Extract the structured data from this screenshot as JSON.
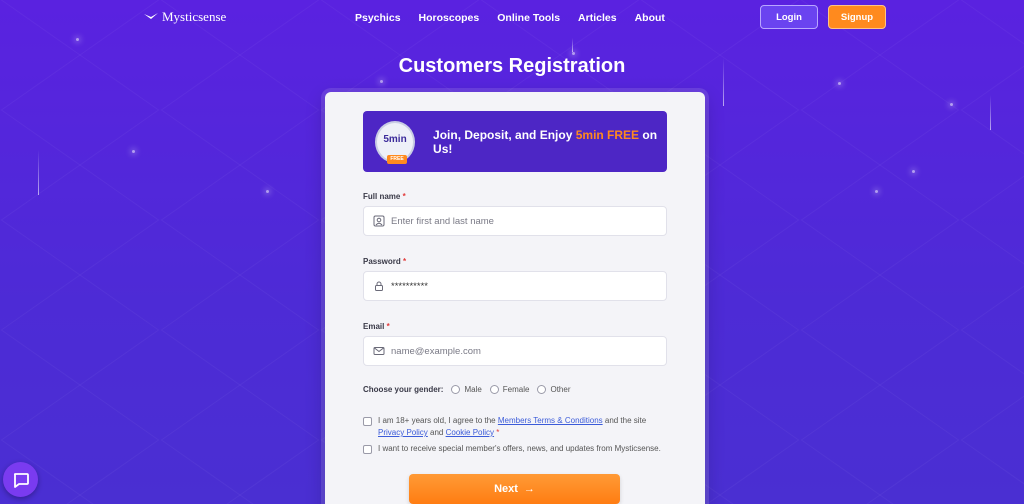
{
  "header": {
    "logo_text": "Mysticsense",
    "nav": [
      "Psychics",
      "Horoscopes",
      "Online Tools",
      "Articles",
      "About"
    ],
    "login_label": "Login",
    "signup_label": "Signup"
  },
  "page": {
    "title": "Customers Registration"
  },
  "promo": {
    "badge_top": "5min",
    "badge_bottom": "FREE",
    "text_before": "Join, Deposit, and Enjoy ",
    "text_highlight": "5min FREE",
    "text_after": " on Us!"
  },
  "form": {
    "full_name": {
      "label": "Full name",
      "required": "*",
      "placeholder": "Enter first and last name"
    },
    "password": {
      "label": "Password",
      "required": "*",
      "value": "**********"
    },
    "email": {
      "label": "Email",
      "required": "*",
      "placeholder": "name@example.com"
    },
    "gender": {
      "label": "Choose your gender:",
      "options": [
        "Male",
        "Female",
        "Other"
      ]
    },
    "terms": {
      "text1": "I am 18+ years old, I agree to the ",
      "link1": "Members Terms & Conditions",
      "text2": " and the site ",
      "link2": "Privacy Policy",
      "text3": " and ",
      "link3": "Cookie Policy",
      "required": " *"
    },
    "offers": "I want to receive special member's offers, news, and updates from Mysticsense.",
    "next_label": "Next",
    "next_arrow": "→"
  },
  "colors": {
    "accent": "#ff8a1e",
    "primary": "#5a22e0",
    "link": "#3b5bd9"
  },
  "icons": {
    "logo": "mysticsense-bird-icon",
    "name_field": "user-card-icon",
    "password_field": "lock-icon",
    "email_field": "envelope-icon",
    "chat": "chat-bubble-icon"
  }
}
